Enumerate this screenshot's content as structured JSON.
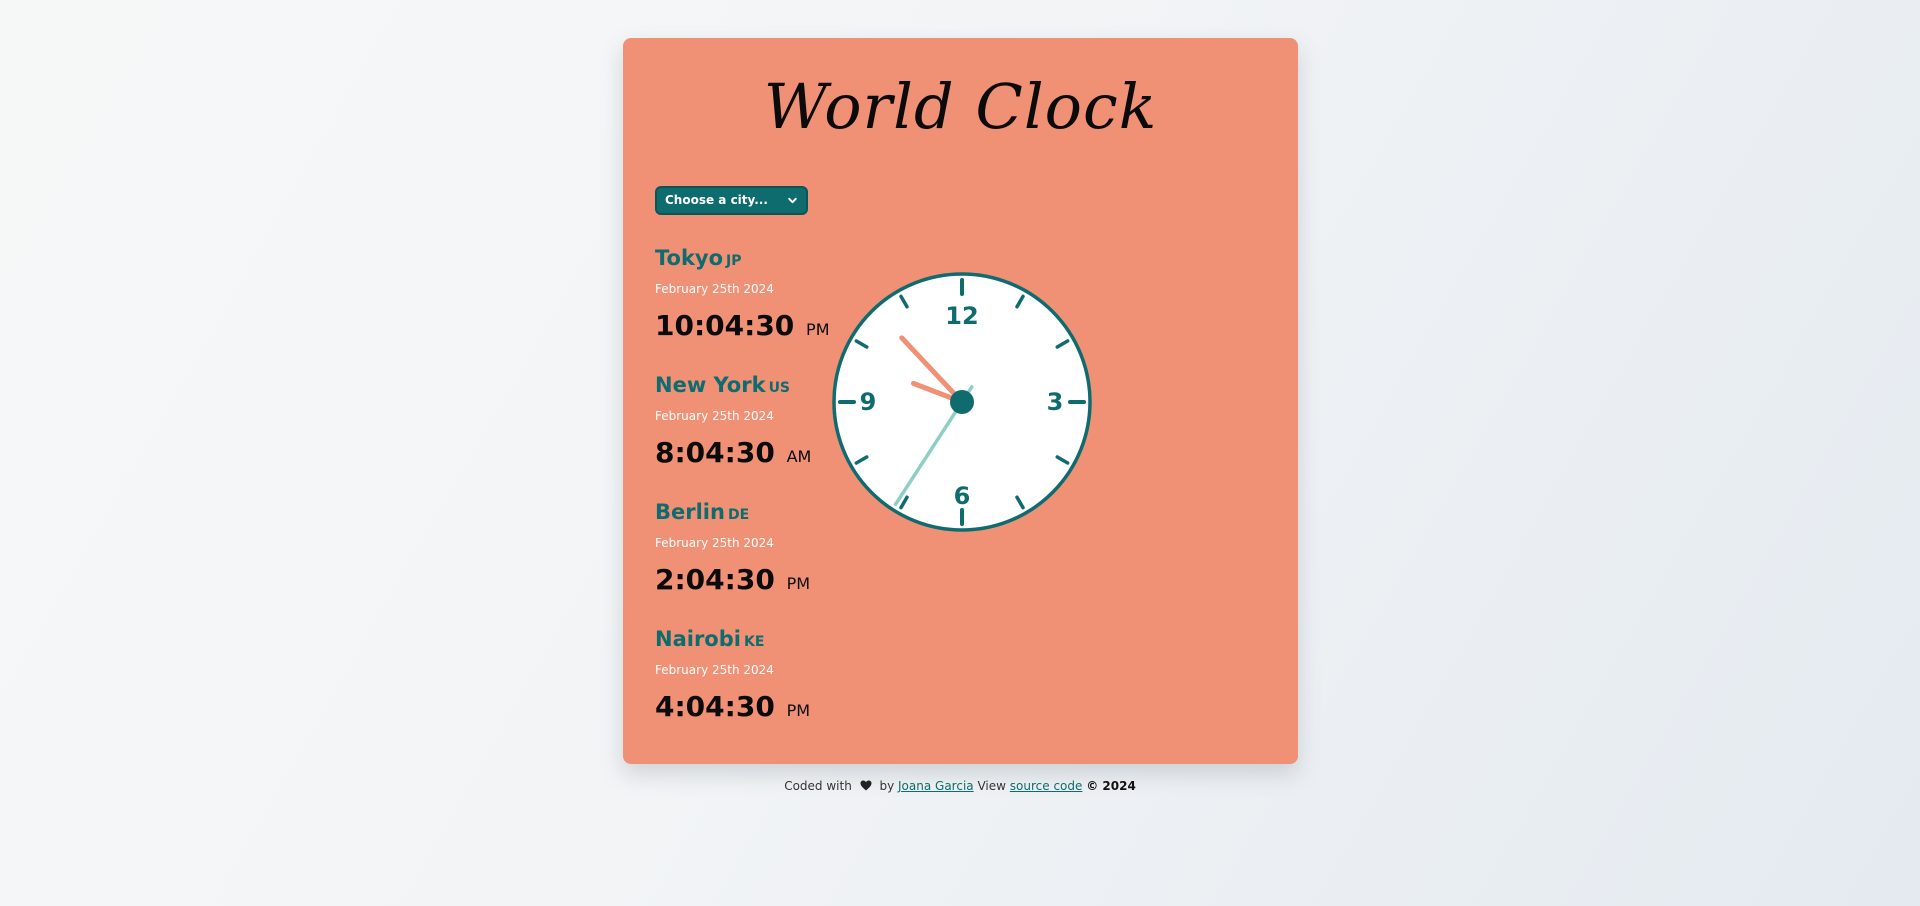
{
  "header": {
    "title": "World Clock"
  },
  "selector": {
    "placeholder": "Choose a city...",
    "icon": "chevron-down-icon"
  },
  "cities": [
    {
      "name": "Tokyo",
      "country": "JP",
      "date": "February 25th 2024",
      "time": "10:04:30",
      "ampm": "PM"
    },
    {
      "name": "New York",
      "country": "US",
      "date": "February 25th 2024",
      "time": "8:04:30",
      "ampm": "AM"
    },
    {
      "name": "Berlin",
      "country": "DE",
      "date": "February 25th 2024",
      "time": "2:04:30",
      "ampm": "PM"
    },
    {
      "name": "Nairobi",
      "country": "KE",
      "date": "February 25th 2024",
      "time": "4:04:30",
      "ampm": "PM"
    }
  ],
  "analog_clock": {
    "numerals": [
      "12",
      "3",
      "6",
      "9"
    ],
    "hour": 9.7,
    "minute": 52.8,
    "second": 35.5
  },
  "footer": {
    "prefix": "Coded with",
    "by": "by",
    "author": "Joana Garcia",
    "view": "View",
    "source": "source code",
    "copyright": "© 2024",
    "heart_icon": "heart-icon"
  },
  "colors": {
    "card": "#f09075",
    "accent": "#0e6b6e",
    "hour_hand": "#f09075",
    "second_hand": "#8ccfc4",
    "clock_face": "#ffffff"
  }
}
